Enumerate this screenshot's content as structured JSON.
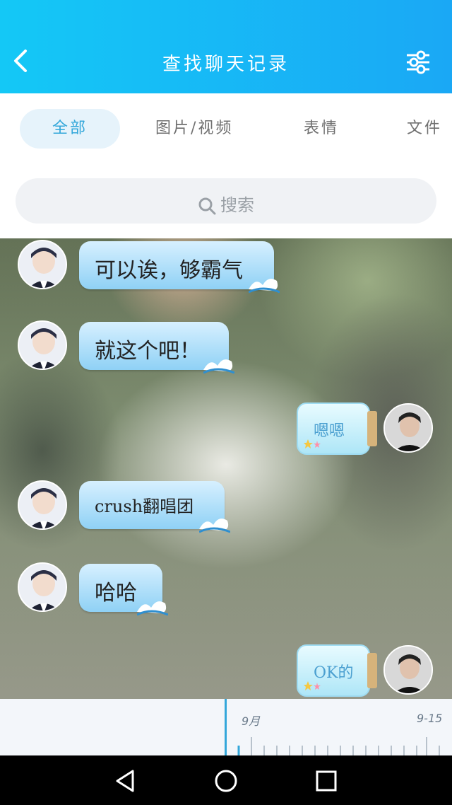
{
  "header": {
    "title": "查找聊天记录"
  },
  "tabs": [
    {
      "label": "全部",
      "active": true
    },
    {
      "label": "图片/视频",
      "active": false
    },
    {
      "label": "表情",
      "active": false
    },
    {
      "label": "文件",
      "active": false
    }
  ],
  "search": {
    "placeholder": "搜索"
  },
  "messages": [
    {
      "side": "left",
      "text": "可以诶，够霸气"
    },
    {
      "side": "left",
      "text": "就这个吧！"
    },
    {
      "side": "right",
      "text": "嗯嗯"
    },
    {
      "side": "left",
      "text": "crush翻唱团"
    },
    {
      "side": "left",
      "text": "哈哈"
    },
    {
      "side": "right",
      "text": "OK的"
    }
  ],
  "timeline": {
    "labels": [
      "9月",
      "9-15"
    ]
  },
  "colors": {
    "accent": "#1aa8f5",
    "bubble": "#8fd1f5"
  }
}
